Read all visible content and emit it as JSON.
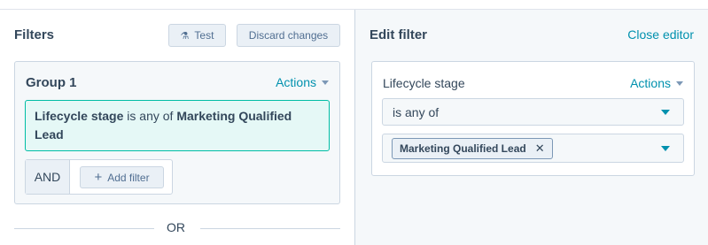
{
  "filters": {
    "title": "Filters",
    "test_label": "Test",
    "discard_label": "Discard changes",
    "group": {
      "title": "Group 1",
      "actions_label": "Actions",
      "filter": {
        "property": "Lifecycle stage",
        "operator": "is any of",
        "value": "Marketing Qualified Lead"
      },
      "and_label": "AND",
      "add_filter_label": "Add filter"
    },
    "or_label": "OR"
  },
  "editor": {
    "title": "Edit filter",
    "close_label": "Close editor",
    "property_label": "Lifecycle stage",
    "actions_label": "Actions",
    "operator_value": "is any of",
    "selected_tags": [
      "Marketing Qualified Lead"
    ]
  },
  "colors": {
    "accent": "#0091ae",
    "filter_highlight": "#e5f8f6",
    "filter_border": "#00bda5",
    "text": "#33475b"
  },
  "icons": {
    "test": "flask-icon",
    "add": "plus-icon",
    "remove_tag": "close-icon",
    "dropdown": "caret-down-icon"
  }
}
